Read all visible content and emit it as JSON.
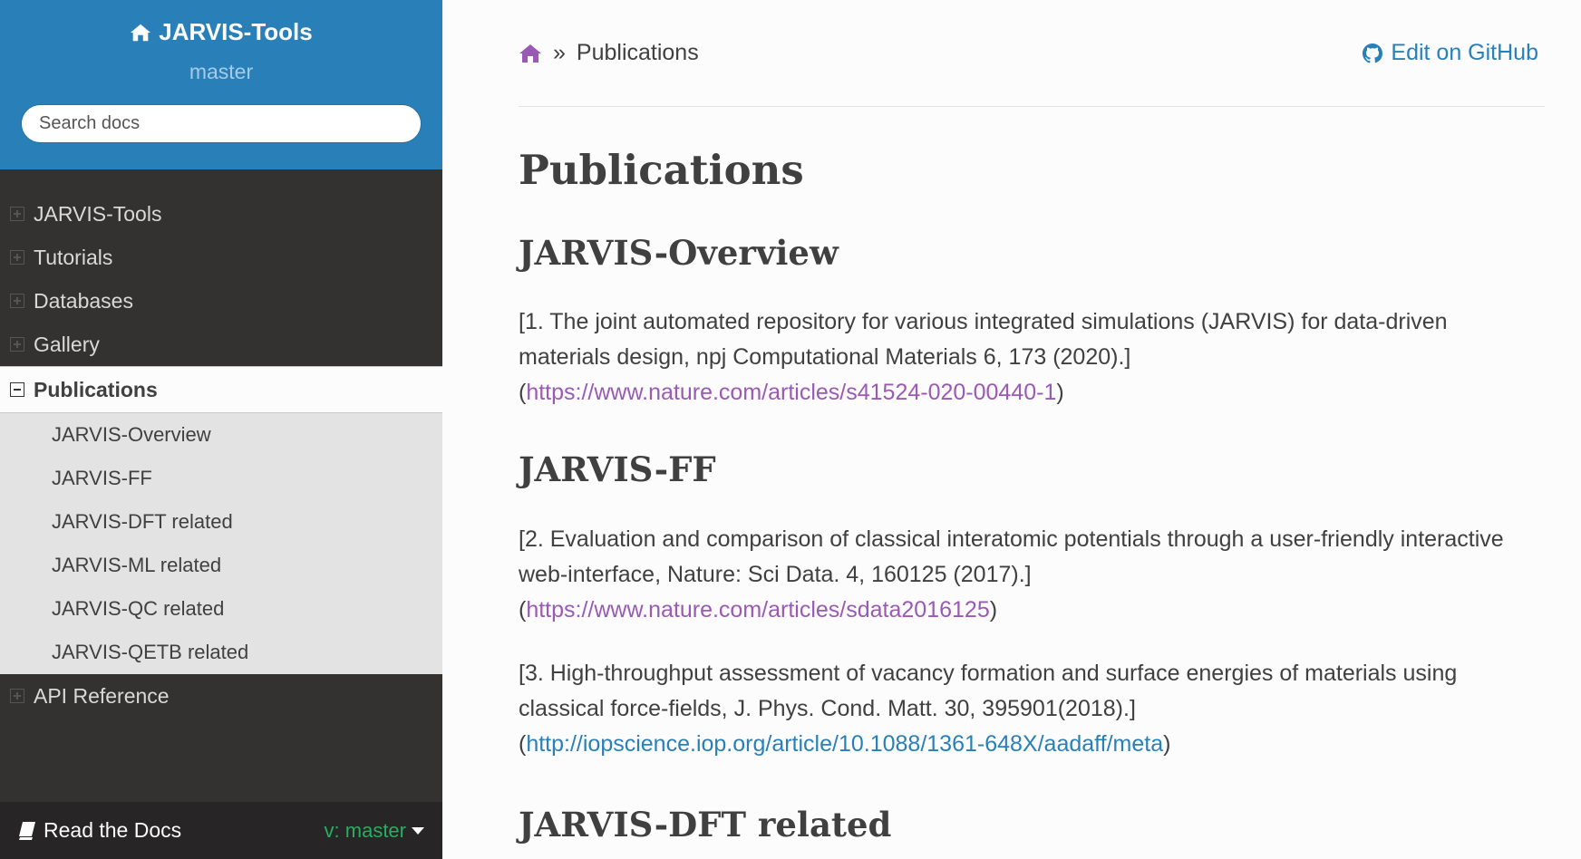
{
  "sidebar": {
    "brand": "JARVIS-Tools",
    "version": "master",
    "search_placeholder": "Search docs",
    "items": [
      {
        "label": "JARVIS-Tools"
      },
      {
        "label": "Tutorials"
      },
      {
        "label": "Databases"
      },
      {
        "label": "Gallery"
      }
    ],
    "current": {
      "label": "Publications",
      "children": [
        {
          "label": "JARVIS-Overview"
        },
        {
          "label": "JARVIS-FF"
        },
        {
          "label": "JARVIS-DFT related"
        },
        {
          "label": "JARVIS-ML related"
        },
        {
          "label": "JARVIS-QC related"
        },
        {
          "label": "JARVIS-QETB related"
        }
      ]
    },
    "after_items": [
      {
        "label": "API Reference"
      }
    ],
    "footer": {
      "label": "Read the Docs",
      "version": "v: master"
    }
  },
  "breadcrumb": {
    "separator": "»",
    "current": "Publications",
    "edit_label": "Edit on GitHub"
  },
  "main": {
    "title": "Publications",
    "sections": [
      {
        "heading": "JARVIS-Overview",
        "refs": [
          {
            "text": "[1. The joint automated repository for various integrated simulations (JARVIS) for data-driven materials design, npj Computational Materials 6, 173 (2020).]",
            "url": "https://www.nature.com/articles/s41524-020-00440-1"
          }
        ]
      },
      {
        "heading": "JARVIS-FF",
        "refs": [
          {
            "text": "[2. Evaluation and comparison of classical interatomic potentials through a user-friendly interactive web-interface, Nature: Sci Data. 4, 160125 (2017).]",
            "url": "https://www.nature.com/articles/sdata2016125"
          },
          {
            "text": "[3. High-throughput assessment of vacancy formation and surface energies of materials using classical force-fields, J. Phys. Cond. Matt. 30, 395901(2018).]",
            "url": "http://iopscience.iop.org/article/10.1088/1361-648X/aadaff/meta"
          }
        ]
      },
      {
        "heading": "JARVIS-DFT related"
      }
    ]
  },
  "colors": {
    "sidebar_top": "#2980b9",
    "sidebar_bg": "#343131",
    "link_visited": "#9b59b6",
    "link": "#2980b9",
    "version_green": "#27ae60"
  },
  "punct": {
    "open": "(",
    "close": ")"
  }
}
